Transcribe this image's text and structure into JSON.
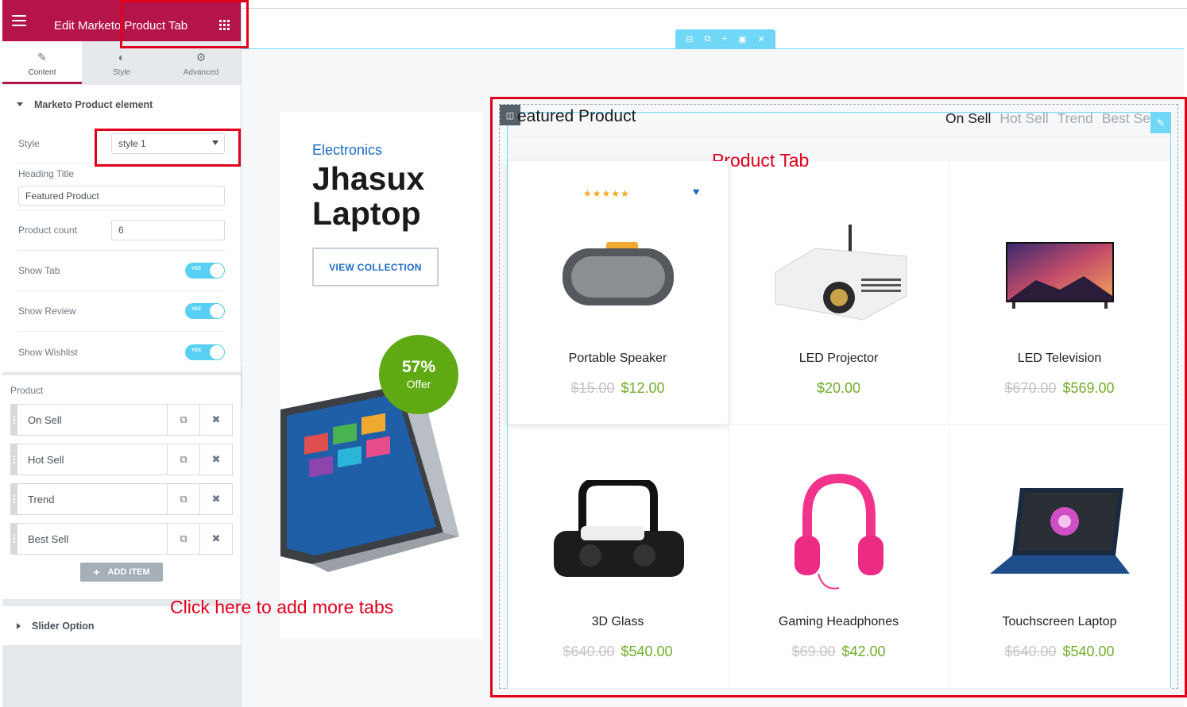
{
  "sidebar": {
    "header_title": "Edit Marketo Product Tab",
    "tabs": [
      {
        "label": "Content",
        "icon": "pencil-icon"
      },
      {
        "label": "Style",
        "icon": "contrast-icon"
      },
      {
        "label": "Advanced",
        "icon": "gear-icon"
      }
    ],
    "section_title": "Marketo Product element",
    "controls": {
      "style_label": "Style",
      "style_value": "style 1",
      "heading_label": "Heading Title",
      "heading_value": "Featured Product",
      "count_label": "Product count",
      "count_value": "6",
      "show_tab_label": "Show Tab",
      "show_review_label": "Show Review",
      "show_wishlist_label": "Show Wishlist",
      "toggle_yes": "YES"
    },
    "repeater": {
      "label": "Product",
      "items": [
        "On Sell",
        "Hot Sell",
        "Trend",
        "Best Sell"
      ],
      "add_label": "ADD ITEM"
    },
    "slider_section_title": "Slider Option"
  },
  "promo": {
    "category": "Electronics",
    "title": "Jhasux Laptop",
    "cta": "VIEW COLLECTION",
    "badge_percent": "57%",
    "badge_text": "Offer"
  },
  "product_tab": {
    "heading": "eatured Product",
    "tabs": [
      "On Sell",
      "Hot Sell",
      "Trend",
      "Best Se"
    ],
    "active_tab": "On Sell",
    "products": [
      {
        "name": "Portable Speaker",
        "old_price": "$15.00",
        "price": "$12.00",
        "stars": "★★★★★"
      },
      {
        "name": "LED Projector",
        "old_price": "",
        "price": "$20.00"
      },
      {
        "name": "LED Television",
        "old_price": "$670.00",
        "price": "$569.00"
      },
      {
        "name": "3D Glass",
        "old_price": "$640.00",
        "price": "$540.00"
      },
      {
        "name": "Gaming Headphones",
        "old_price": "$69.00",
        "price": "$42.00"
      },
      {
        "name": "Touchscreen Laptop",
        "old_price": "$640.00",
        "price": "$540.00"
      }
    ]
  },
  "annotations": {
    "product_tab_label": "Product Tab",
    "add_tabs_hint": "Click here to add more tabs",
    "color": "#e0001b"
  },
  "colors": {
    "brand": "#b5144a",
    "accent": "#71d7f7",
    "price_green": "#72ad2a",
    "link_blue": "#1c6ac7"
  }
}
